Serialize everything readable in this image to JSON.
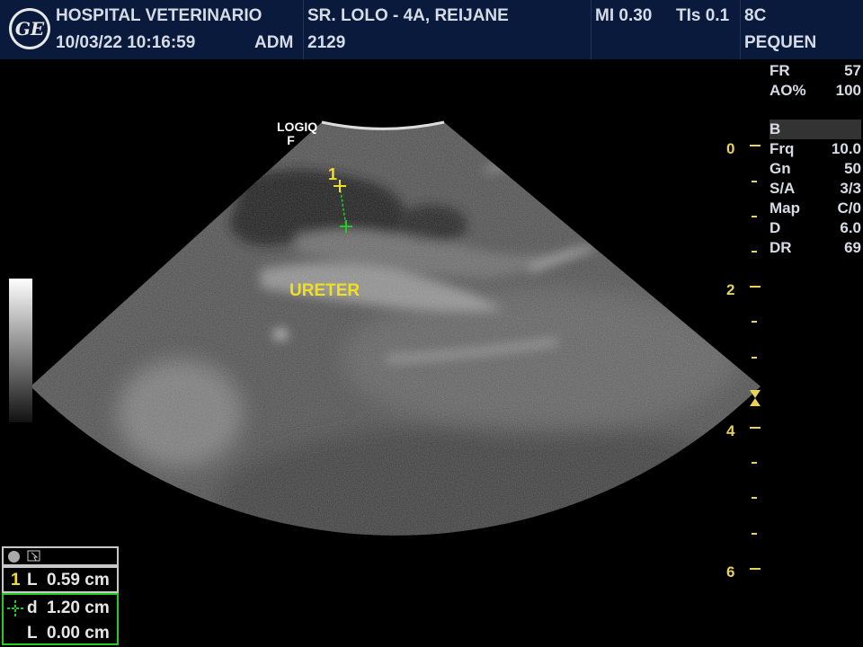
{
  "header": {
    "logo_text": "GE",
    "facility": "HOSPITAL VETERINARIO",
    "datetime": "10/03/22 10:16:59",
    "operator": "ADM",
    "patient": "SR. LOLO - 4A, REIJANE",
    "patient_id": "2129",
    "mi": "MI 0.30",
    "tis": "TIs 0.1",
    "probe": "8C",
    "preset": "PEQUEN"
  },
  "params": {
    "top": [
      {
        "key": "FR",
        "value": "57"
      },
      {
        "key": "AO%",
        "value": "100"
      }
    ],
    "mode": "B",
    "bmode": [
      {
        "key": "Frq",
        "value": "10.0"
      },
      {
        "key": "Gn",
        "value": "50"
      },
      {
        "key": "S/A",
        "value": "3/3"
      },
      {
        "key": "Map",
        "value": "C/0"
      },
      {
        "key": "D",
        "value": "6.0"
      },
      {
        "key": "DR",
        "value": "69"
      }
    ]
  },
  "depth_scale": {
    "labels": [
      "0",
      "2",
      "4",
      "6"
    ],
    "unit_max_cm": 6
  },
  "image": {
    "probe_logo": "LOGIQ",
    "probe_logo_sub": "F",
    "annotation": "URETER",
    "caliper_id": "1"
  },
  "measurements": {
    "header_icon": "cursor-icon",
    "caliper_id": "1",
    "line1_key": "L",
    "line1_value": "0.59 cm",
    "line2_key": "d",
    "line2_value": "1.20 cm",
    "line3_key": "L",
    "line3_value": "0.00 cm"
  },
  "colors": {
    "header_bg": "#0a1a3c",
    "text": "#d6dce6",
    "accent_yellow": "#e8d25a",
    "caliper_green": "#22cc22",
    "annotation_yellow": "#f0e020"
  }
}
